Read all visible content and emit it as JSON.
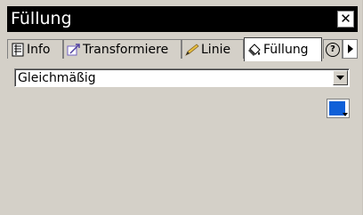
{
  "window": {
    "title": "Füllung",
    "close_icon": "close-icon"
  },
  "tabs": [
    {
      "label": "Info",
      "icon": "info-icon"
    },
    {
      "label": "Transformiere",
      "icon": "transform-icon"
    },
    {
      "label": "Linie",
      "icon": "pencil-icon"
    },
    {
      "label": "Füllung",
      "icon": "paint-bucket-icon",
      "active": true
    }
  ],
  "help_tab": {
    "icon": "help-icon",
    "symbol": "?"
  },
  "scroll_arrow": {
    "icon": "arrow-right-icon"
  },
  "fill": {
    "type_selected": "Gleichmäßig",
    "color": "#1060d8"
  },
  "colors": {
    "titlebar": "#000000",
    "panel": "#d4d0c8",
    "swatch": "#1060d8"
  }
}
